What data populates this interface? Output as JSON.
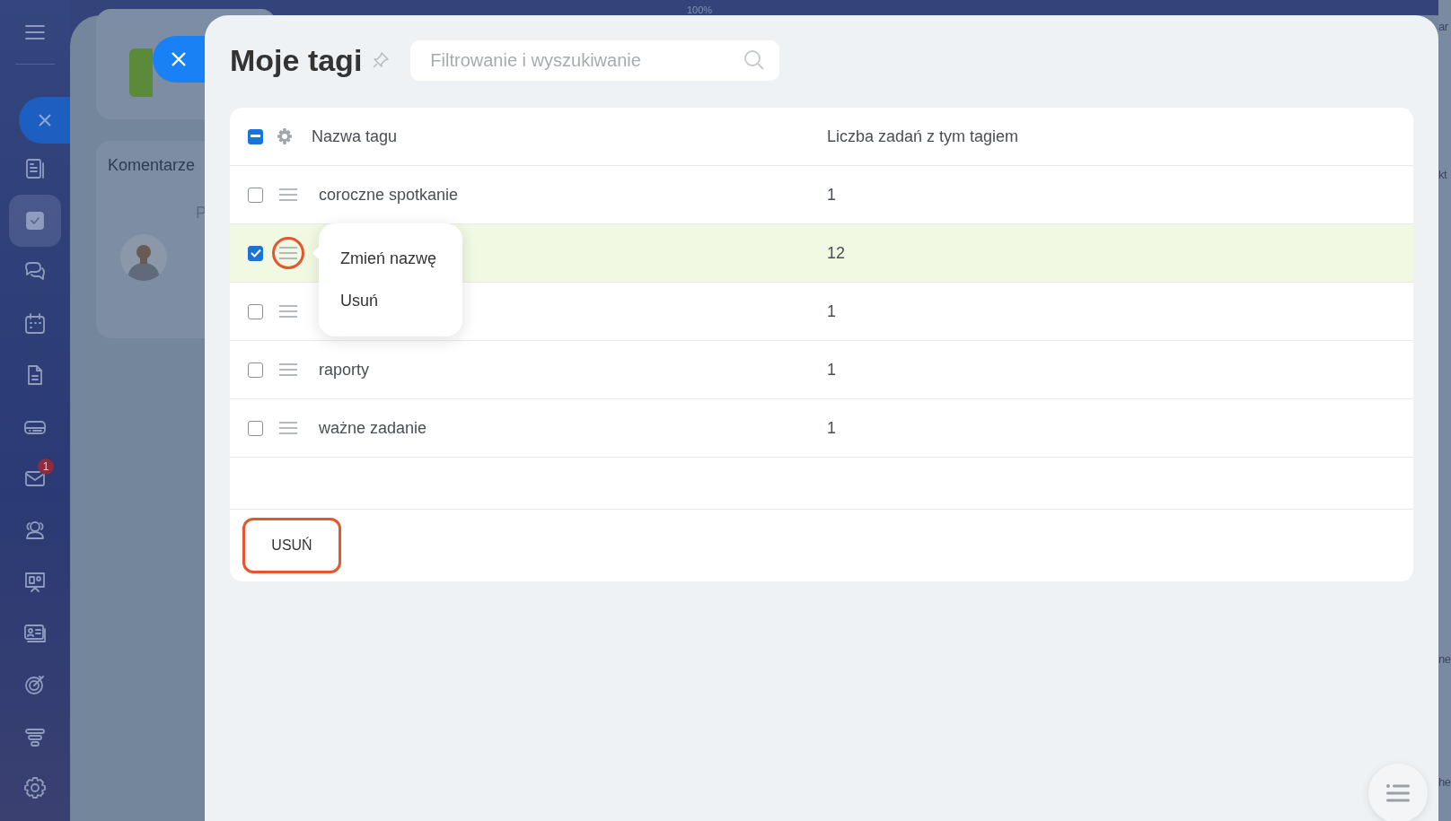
{
  "zoom_label": "100%",
  "sidebar": {
    "items": [
      {
        "kind": "menu",
        "selected": false
      },
      {
        "kind": "close",
        "selected": false
      },
      {
        "kind": "news",
        "selected": false
      },
      {
        "kind": "tasks",
        "selected": true
      },
      {
        "kind": "chat",
        "selected": false
      },
      {
        "kind": "calendar",
        "selected": false
      },
      {
        "kind": "document",
        "selected": false
      },
      {
        "kind": "drive",
        "selected": false
      },
      {
        "kind": "mail",
        "selected": false,
        "badge": "1"
      },
      {
        "kind": "people",
        "selected": false
      },
      {
        "kind": "board",
        "selected": false
      },
      {
        "kind": "contacts",
        "selected": false
      },
      {
        "kind": "target",
        "selected": false
      },
      {
        "kind": "funnel",
        "selected": false
      },
      {
        "kind": "settings",
        "selected": false
      }
    ]
  },
  "background": {
    "comments_title": "Komentarze",
    "comment_fragment": "P",
    "right_fragments": [
      "ar",
      "kt",
      "ne",
      "he"
    ]
  },
  "panel": {
    "title": "Moje tagi",
    "search": {
      "placeholder": "Filtrowanie i wyszukiwanie"
    },
    "table": {
      "header_checkbox": {
        "indeterminate": true
      },
      "columns": [
        "Nazwa tagu",
        "Liczba zadań z tym tagiem"
      ],
      "rows": [
        {
          "name": "coroczne spotkanie",
          "count": "1",
          "checked": false,
          "menu_highlighted": false
        },
        {
          "count": "12",
          "checked": true,
          "menu_highlighted": true,
          "context_menu": {
            "items": [
              "Zmień nazwę",
              "Usuń"
            ]
          }
        },
        {
          "count": "1",
          "checked": false,
          "menu_highlighted": false
        },
        {
          "name": "raporty",
          "count": "1",
          "checked": false,
          "menu_highlighted": false
        },
        {
          "name": "ważne zadanie",
          "count": "1",
          "checked": false,
          "menu_highlighted": false
        }
      ]
    },
    "footer_button": {
      "label": "USUŃ",
      "highlighted": true
    }
  }
}
